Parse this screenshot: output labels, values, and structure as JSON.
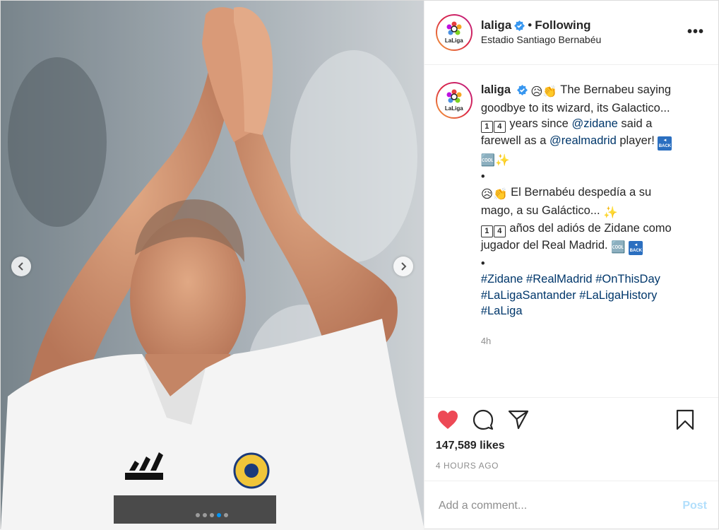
{
  "header": {
    "username": "laliga",
    "separator": "•",
    "follow_status": "Following",
    "location": "Estadio Santiago Bernabéu",
    "more_label": "•••",
    "logo_text": "LaLiga"
  },
  "caption": {
    "username": "laliga",
    "line1_text": "The Bernabeu saying",
    "line2_text": "goodbye to its wizard, its Galactico...",
    "line3_text": "years since",
    "line3_mention": "@zidane",
    "line3_tail": "said a",
    "line4_text": "farewell as a",
    "line4_mention": "@realmadrid",
    "line4_tail": "player!",
    "dot": "•",
    "line7_text": "El Bernabéu despedía a su",
    "line8_text": "mago, a su Galáctico...",
    "line9_text": "años del adiós de Zidane como",
    "line10_text": "jugador del Real Madrid.",
    "dot2": "•",
    "hashtags_line1": [
      "#Zidane",
      "#RealMadrid",
      "#OnThisDay"
    ],
    "hashtags_line2": [
      "#LaLigaSantander",
      "#LaLigaHistory"
    ],
    "hashtags_line3": [
      "#LaLiga"
    ],
    "keycap_1": "1",
    "keycap_4": "4",
    "back_label": "BACK",
    "time": "4h"
  },
  "actions": {
    "likes": "147,589 likes",
    "posted": "4 HOURS AGO"
  },
  "comment_box": {
    "placeholder": "Add a comment...",
    "post_label": "Post"
  },
  "carousel": {
    "dot_count": 5,
    "active_index": 3
  },
  "colors": {
    "heart": "#ed4956",
    "link": "#00376b",
    "verified": "#3897f0",
    "post_disabled": "#b2dffc"
  }
}
